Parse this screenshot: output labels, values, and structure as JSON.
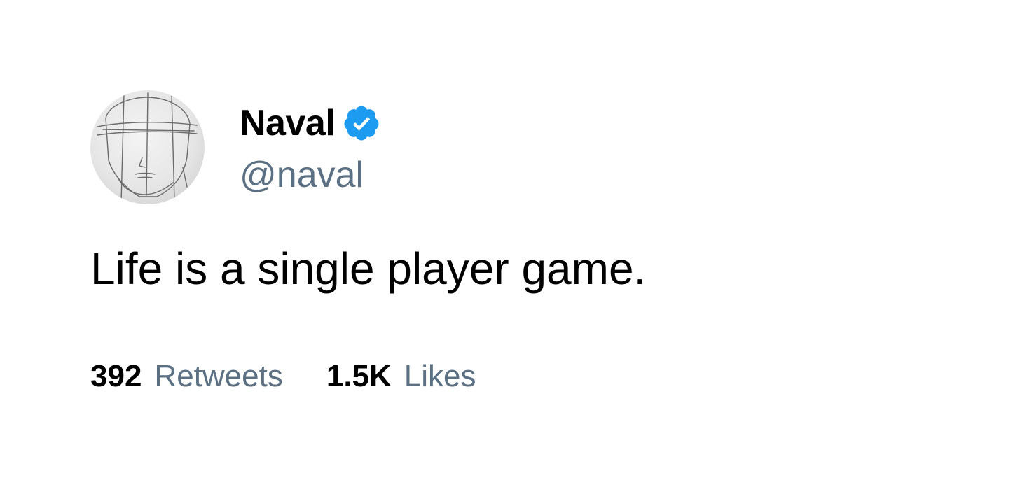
{
  "user": {
    "display_name": "Naval",
    "handle": "@naval",
    "verified": true,
    "avatar_icon": "sketched-face-avatar",
    "verified_icon": "verified-badge-icon"
  },
  "tweet": {
    "text": "Life is a single player game."
  },
  "stats": {
    "retweets_count": "392",
    "retweets_label": "Retweets",
    "likes_count": "1.5K",
    "likes_label": "Likes"
  },
  "colors": {
    "verified_blue": "#1d9bf0",
    "secondary_text": "#5b7083",
    "primary_text": "#000000",
    "background": "#ffffff"
  }
}
